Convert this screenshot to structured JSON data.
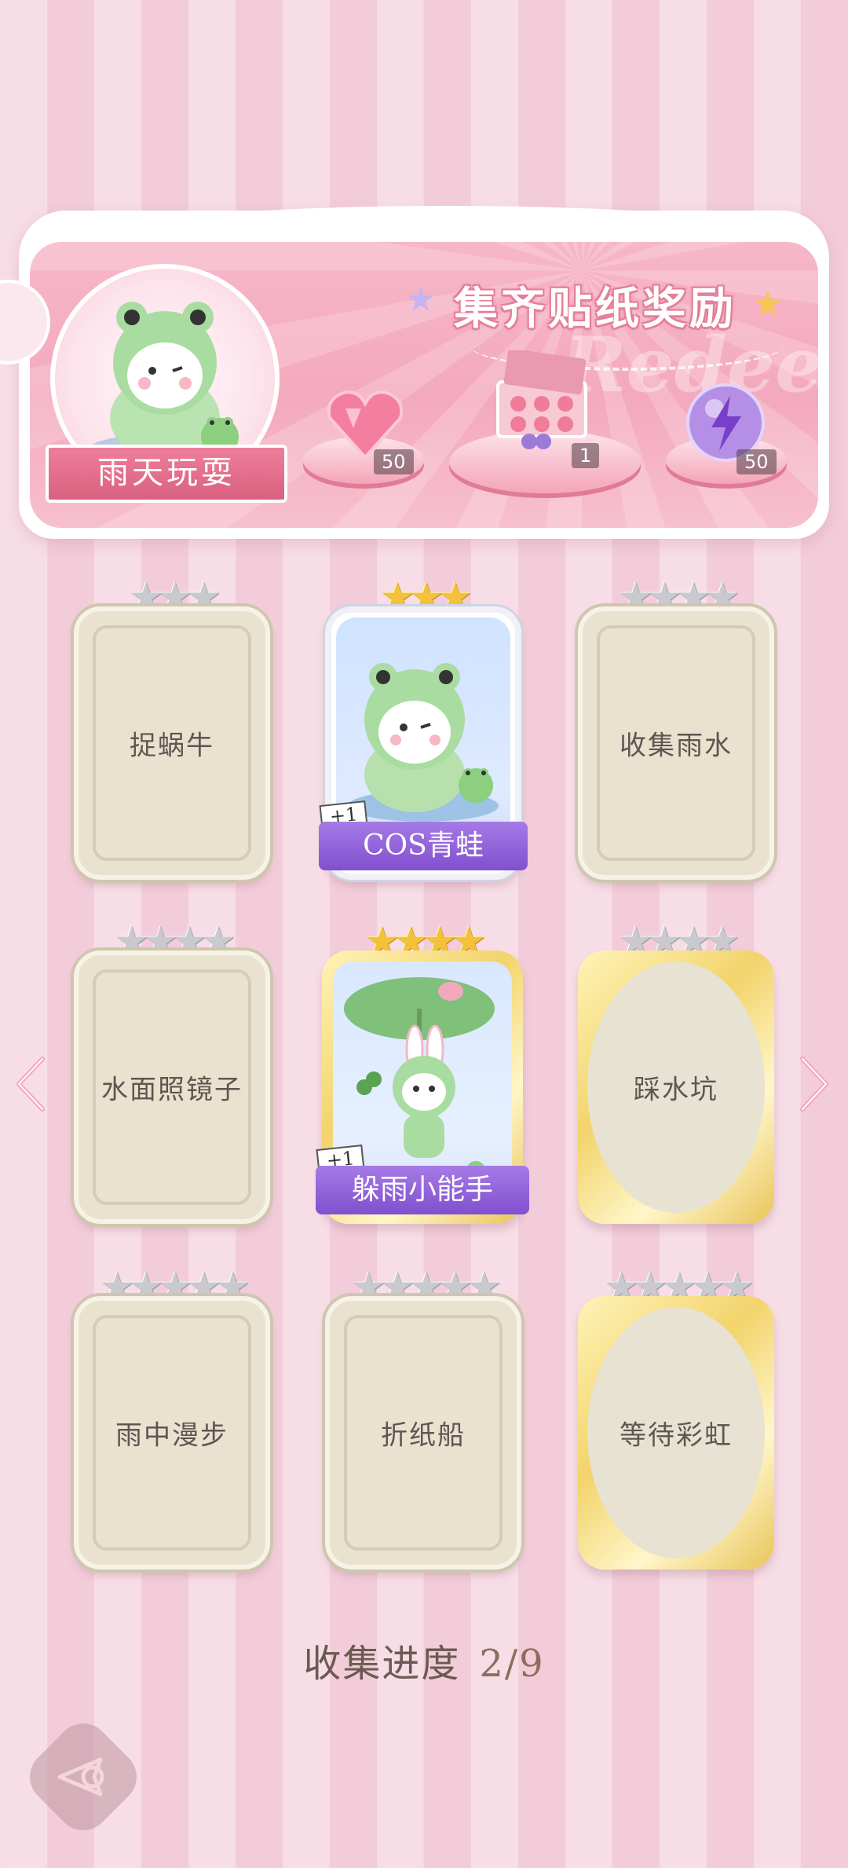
{
  "banner": {
    "title": "集齐贴纸奖励",
    "watermark": "Redeem",
    "theme_label": "雨天玩耍",
    "rewards": [
      {
        "icon": "pink-heart-gem-icon",
        "count": "50"
      },
      {
        "icon": "gift-box-icon",
        "count": "1"
      },
      {
        "icon": "purple-lightning-orb-icon",
        "count": "50"
      }
    ]
  },
  "cards": [
    {
      "label": "捉蜗牛",
      "stars": 3,
      "star_color": "silver",
      "frame": "plain",
      "owned": false
    },
    {
      "label": "COS青蛙",
      "stars": 3,
      "star_color": "gold",
      "frame": "silver",
      "owned": true,
      "plus": "+1"
    },
    {
      "label": "收集雨水",
      "stars": 4,
      "star_color": "silver",
      "frame": "plain",
      "owned": false
    },
    {
      "label": "水面照镜子",
      "stars": 4,
      "star_color": "silver",
      "frame": "plain",
      "owned": false
    },
    {
      "label": "躲雨小能手",
      "stars": 4,
      "star_color": "gold",
      "frame": "gold",
      "owned": true,
      "plus": "+1"
    },
    {
      "label": "踩水坑",
      "stars": 4,
      "star_color": "silver",
      "frame": "gold",
      "owned": false
    },
    {
      "label": "雨中漫步",
      "stars": 5,
      "star_color": "silver",
      "frame": "plain",
      "owned": false
    },
    {
      "label": "折纸船",
      "stars": 5,
      "star_color": "silver",
      "frame": "plain",
      "owned": false
    },
    {
      "label": "等待彩虹",
      "stars": 5,
      "star_color": "silver",
      "frame": "gold",
      "owned": false
    }
  ],
  "progress": {
    "label": "收集进度",
    "value": "2/9"
  },
  "nav": {
    "prev_icon": "chevron-left-icon",
    "next_icon": "chevron-right-icon",
    "back_icon": "back-arrow-icon"
  },
  "colors": {
    "accent_pink": "#f4a9bd",
    "gold": "#f3c23a",
    "purple_banner": "#8150cf"
  }
}
